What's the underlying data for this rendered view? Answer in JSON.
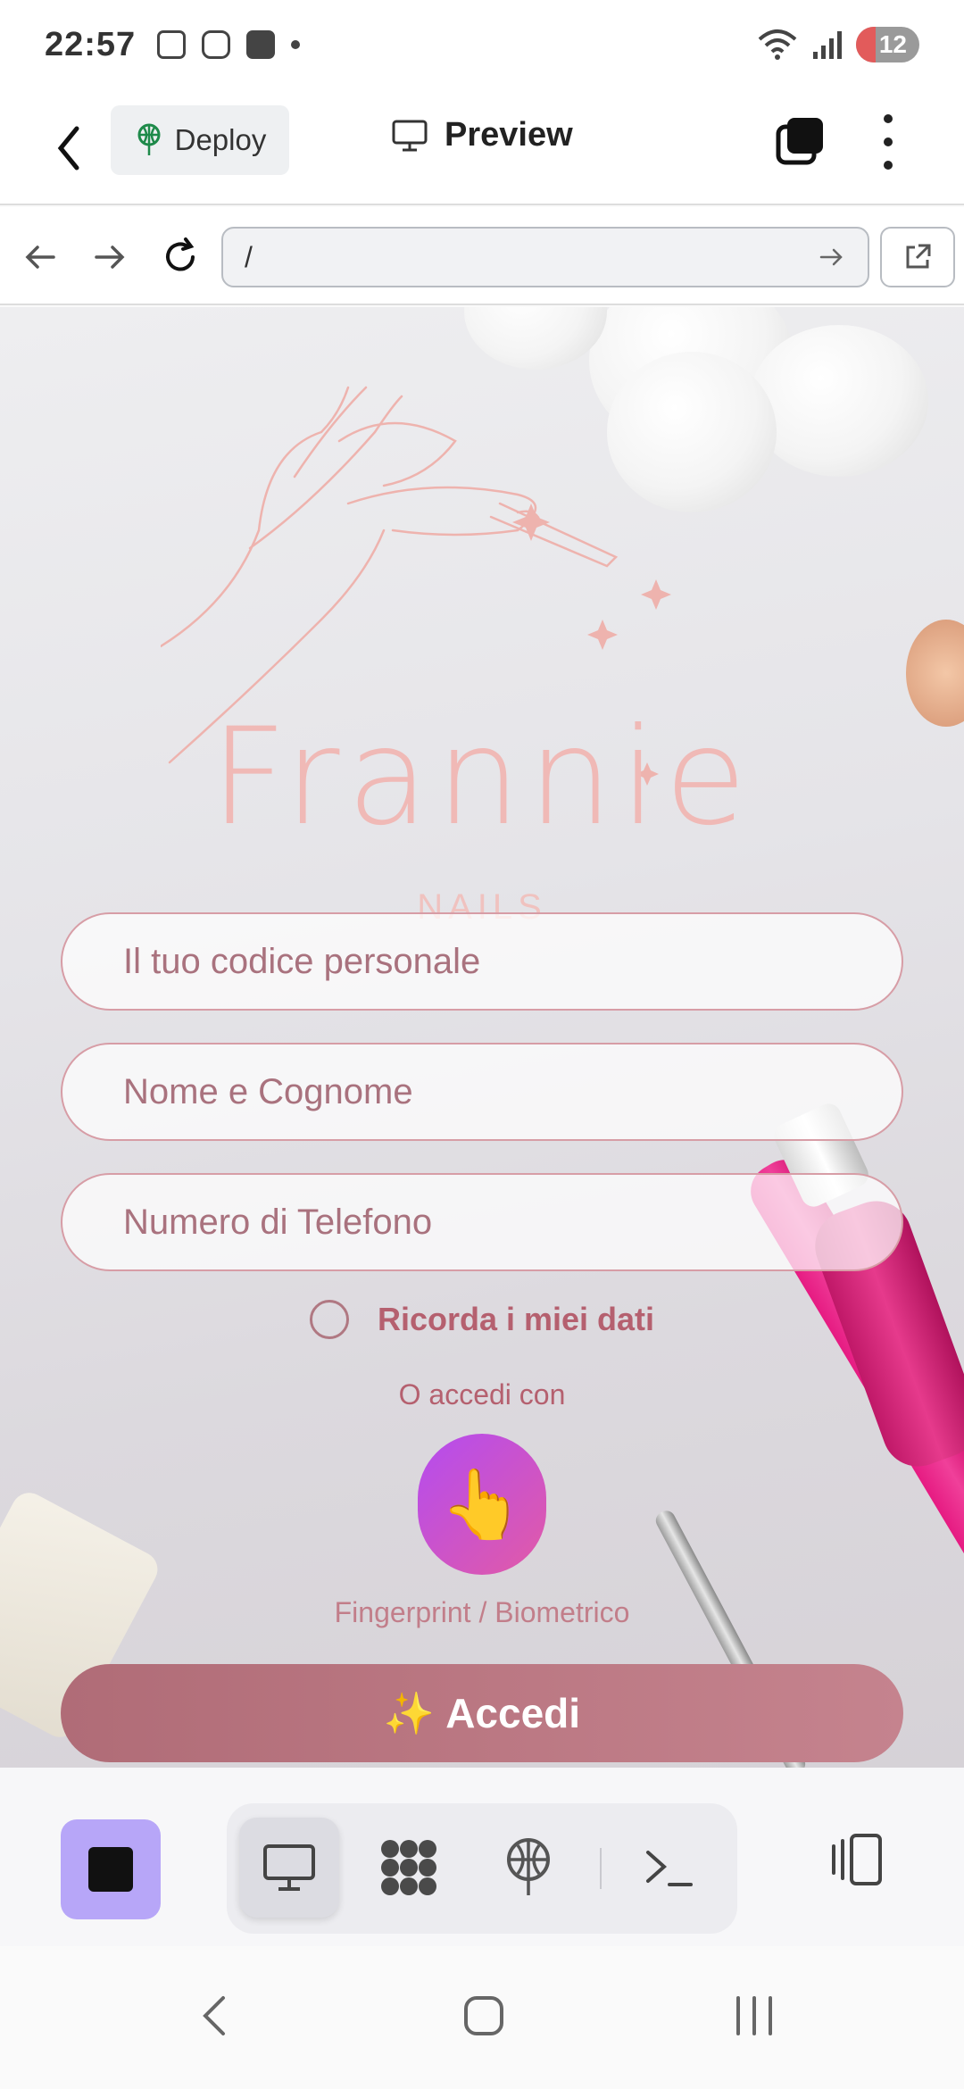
{
  "status_bar": {
    "time": "22:57",
    "battery": "12"
  },
  "app_bar": {
    "deploy_label": "Deploy",
    "preview_label": "Preview"
  },
  "browser": {
    "url": "/"
  },
  "page": {
    "brand_name": "Frannie",
    "brand_sub": "NAILS",
    "code_placeholder": "Il tuo codice personale",
    "name_placeholder": "Nome e Cognome",
    "phone_placeholder": "Numero di Telefono",
    "remember_label": "Ricorda i miei dati",
    "or_text": "O accedi con",
    "fingerprint_emoji": "👆",
    "fingerprint_label": "Fingerprint / Biometrico",
    "login_emoji": "✨",
    "login_label": "Accedi"
  },
  "colors": {
    "accent_purple": "#b7a6f8",
    "brand_pink": "#f0b9b6",
    "login_button": "#b06c77",
    "fingerprint_gradient": [
      "#b44cf0",
      "#e25aa6"
    ]
  },
  "icons": {
    "dock": [
      "stop-icon",
      "monitor-icon",
      "grid-icon",
      "deploy-icon",
      "terminal-icon",
      "split-view-icon"
    ]
  }
}
